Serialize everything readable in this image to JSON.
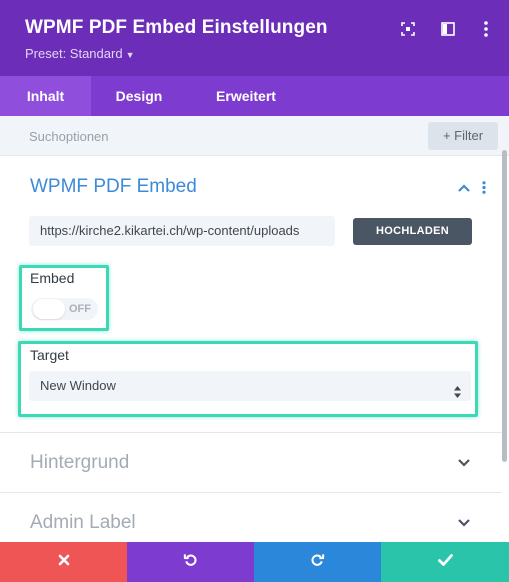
{
  "header": {
    "title": "WPMF PDF Embed Einstellungen",
    "preset_label": "Preset: Standard",
    "icons": [
      "focus-icon",
      "sidebar-layout-icon",
      "more-vertical-icon"
    ]
  },
  "tabs": [
    {
      "label": "Inhalt",
      "active": true
    },
    {
      "label": "Design",
      "active": false
    },
    {
      "label": "Erweitert",
      "active": false
    }
  ],
  "search": {
    "placeholder": "Suchoptionen",
    "filter_label": "+ Filter"
  },
  "sections": {
    "main": {
      "title": "WPMF PDF Embed",
      "expanded": true,
      "url_value": "https://kirche2.kikartei.ch/wp-content/uploads",
      "upload_label": "HOCHLADEN",
      "embed": {
        "label": "Embed",
        "state_label": "OFF",
        "enabled": false
      },
      "target": {
        "label": "Target",
        "selected": "New Window"
      }
    },
    "background": {
      "title": "Hintergrund",
      "expanded": false
    },
    "admin_label": {
      "title": "Admin Label",
      "expanded": false
    }
  },
  "footer": {
    "buttons": [
      {
        "name": "cancel",
        "icon": "close-icon",
        "color": "#ef5555"
      },
      {
        "name": "undo",
        "icon": "undo-icon",
        "color": "#7e3bd0"
      },
      {
        "name": "redo",
        "icon": "redo-icon",
        "color": "#2b87da"
      },
      {
        "name": "save",
        "icon": "check-icon",
        "color": "#29c4a9"
      }
    ]
  },
  "colors": {
    "header": "#6c2eb9",
    "tabs": "#7e3bd0",
    "accent_blue": "#3d8ad8",
    "highlight": "#3dd8b5"
  }
}
